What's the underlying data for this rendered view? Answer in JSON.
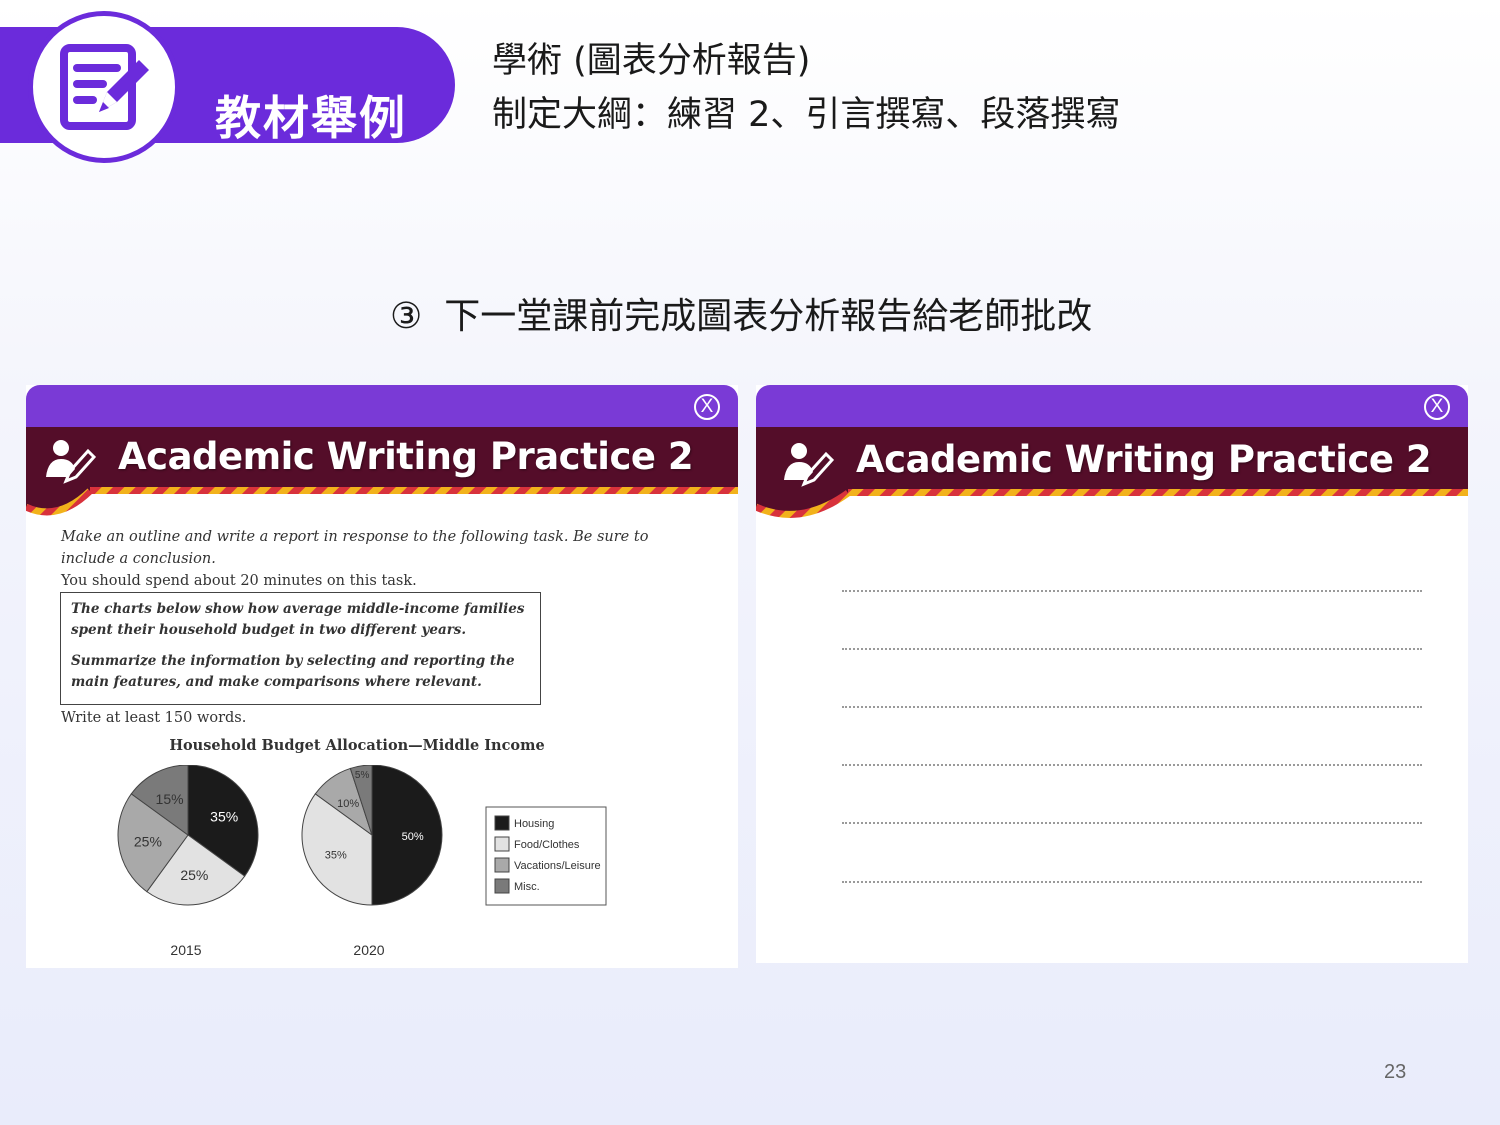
{
  "header": {
    "badge_label": "教材舉例",
    "line1": "學術 (圖表分析報告)",
    "line2": "制定大綱：練習 2、引言撰寫、段落撰寫"
  },
  "subtitle": {
    "marker": "③",
    "text": "下一堂課前完成圖表分析報告給老師批改"
  },
  "left_card": {
    "title": "Academic Writing Practice 2",
    "close_label": "X",
    "instruction": "Make an outline and write a report in response to the following task. Be sure to include a conclusion.",
    "time_note": "You should spend about 20 minutes on this task.",
    "task_line1": "The charts below show how average middle-income families spent their household budget in two different years.",
    "task_line2": "Summarize the information by selecting and reporting the main features, and make comparisons where relevant.",
    "min_words": "Write at least 150 words."
  },
  "chart_data": [
    {
      "type": "pie",
      "title": "Household Budget Allocation—Middle Income",
      "label": "2015",
      "categories": [
        "Housing",
        "Food/Clothes",
        "Vacations/Leisure",
        "Misc."
      ],
      "values": [
        35,
        25,
        25,
        15
      ],
      "value_labels": [
        "35%",
        "25%",
        "25%",
        "15%"
      ],
      "colors": [
        "#1b1b1b",
        "#e2e2e2",
        "#a9a9a9",
        "#7a7a7a"
      ],
      "legend": "right"
    },
    {
      "type": "pie",
      "title": "Household Budget Allocation—Middle Income",
      "label": "2020",
      "categories": [
        "Housing",
        "Food/Clothes",
        "Vacations/Leisure",
        "Misc."
      ],
      "values": [
        50,
        35,
        10,
        5
      ],
      "value_labels": [
        "50%",
        "35%",
        "10%",
        "5%"
      ],
      "colors": [
        "#1b1b1b",
        "#e2e2e2",
        "#a9a9a9",
        "#7a7a7a"
      ],
      "legend": "right"
    }
  ],
  "right_card": {
    "title": "Academic Writing Practice 2",
    "close_label": "X"
  },
  "page_number": "23"
}
